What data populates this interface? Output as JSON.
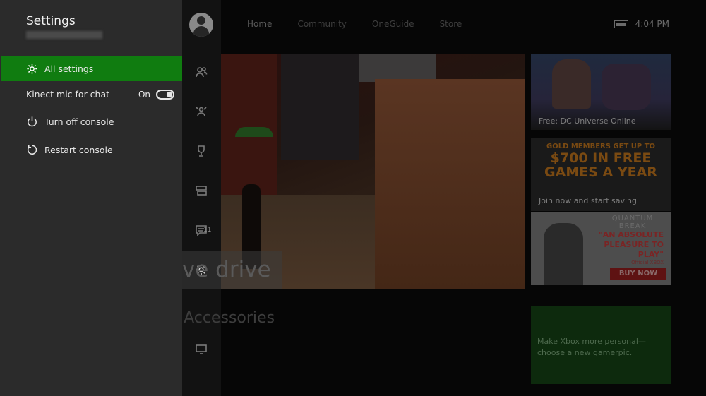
{
  "guide": {
    "title": "Settings",
    "items": [
      {
        "label": "All settings",
        "icon": "gear-icon",
        "selected": true
      },
      {
        "label": "Kinect mic for chat",
        "toggle_state": "On"
      },
      {
        "label": "Turn off console",
        "icon": "power-icon"
      },
      {
        "label": "Restart console",
        "icon": "restart-icon"
      }
    ]
  },
  "topbar": {
    "tabs": [
      "Home",
      "Community",
      "OneGuide",
      "Store"
    ],
    "time": "4:04 PM"
  },
  "rail": {
    "icons": [
      "avatar",
      "friends-icon",
      "party-icon",
      "achievements-icon",
      "snap-icon",
      "messages-icon",
      "settings-icon",
      "tv-icon"
    ],
    "messages_count": "11"
  },
  "home": {
    "hero_caption": "Live drive",
    "section_caption": "Games & Accessories",
    "tiles": {
      "dc": {
        "caption": "Free: DC Universe Online"
      },
      "gold": {
        "line1": "GOLD MEMBERS GET UP TO",
        "line2": "$700 IN FREE",
        "line3": "GAMES A YEAR",
        "caption": "Join now and start saving"
      },
      "quantum": {
        "logo": "QUANTUM BREAK",
        "quote1": "\"AN ABSOLUTE",
        "quote2": "PLEASURE TO",
        "quote3": "PLAY\"",
        "attribution": "Official XBOX",
        "cta": "BUY NOW"
      },
      "gamerpic": {
        "caption": "Make Xbox more personal—choose a new gamerpic."
      }
    }
  },
  "colors": {
    "accent": "#107c10",
    "guide_bg": "#2b2b2b"
  }
}
